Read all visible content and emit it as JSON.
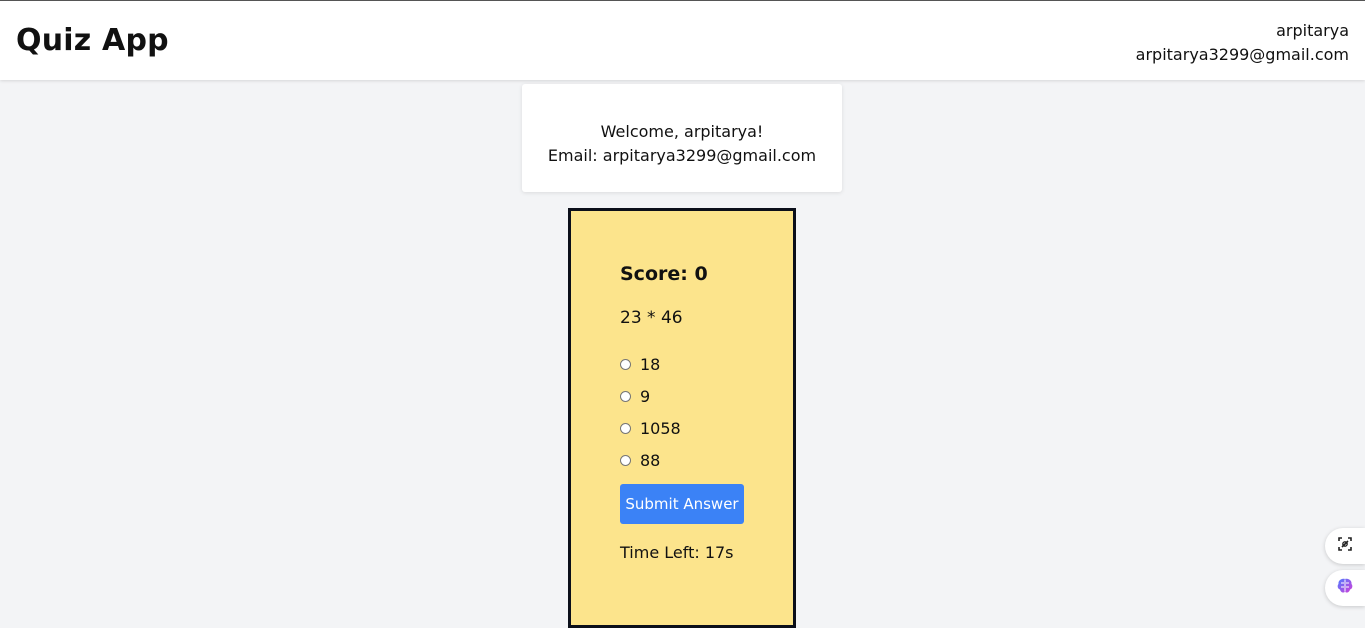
{
  "header": {
    "title": "Quiz App",
    "username": "arpitarya",
    "email": "arpitarya3299@gmail.com"
  },
  "welcome": {
    "greeting": "Welcome, arpitarya!",
    "email_line": "Email: arpitarya3299@gmail.com"
  },
  "quiz": {
    "score": "Score: 0",
    "question": "23 * 46",
    "options": [
      {
        "label": "18"
      },
      {
        "label": "9"
      },
      {
        "label": "1058"
      },
      {
        "label": "88"
      }
    ],
    "submit_label": "Submit Answer",
    "timer": "Time Left: 17s"
  },
  "colors": {
    "background": "#f3f4f6",
    "quiz_card": "#fce48c",
    "quiz_border": "#0b0f1a",
    "submit_button": "#3b82f6"
  },
  "floating_buttons": [
    {
      "icon": "screenshot-crop-icon"
    },
    {
      "icon": "brain-extension-icon"
    }
  ]
}
